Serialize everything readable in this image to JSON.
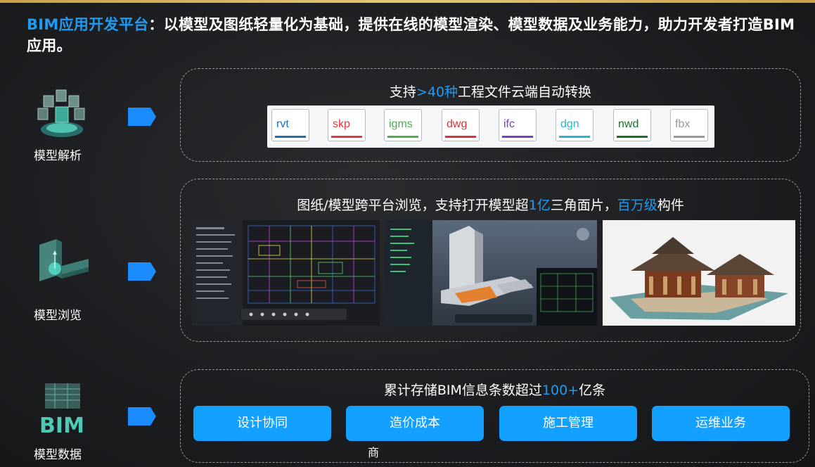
{
  "headline": {
    "accent": "BIM应用开发平台",
    "rest": "：以模型及图纸轻量化为基础，提供在线的模型渲染、模型数据及业务能力，助力开发者打造BIM应用。"
  },
  "rows": [
    {
      "label": "模型解析",
      "icon": "model-parse-icon"
    },
    {
      "label": "模型浏览",
      "icon": "model-browse-icon"
    },
    {
      "label": "模型数据",
      "icon": "bim-data-icon"
    }
  ],
  "panel1": {
    "title_pre": "支持",
    "title_hl": ">40种",
    "title_post": "工程文件云端自动转换",
    "formats": [
      {
        "ext": "rvt",
        "color": "#1f6fb5"
      },
      {
        "ext": "skp",
        "color": "#e03a3e"
      },
      {
        "ext": "igms",
        "color": "#4cae4f"
      },
      {
        "ext": "dwg",
        "color": "#d2363c"
      },
      {
        "ext": "ifc",
        "color": "#7a3fc4"
      },
      {
        "ext": "dgn",
        "color": "#2fb3c8"
      },
      {
        "ext": "nwd",
        "color": "#1b6e2a"
      },
      {
        "ext": "fbx",
        "color": "#9a9a9a"
      }
    ]
  },
  "panel2": {
    "title_pre": "图纸/模型跨平台浏览，支持打开模型超",
    "title_hl1": "1亿",
    "title_mid": "三角面片，",
    "title_hl2": "百万级",
    "title_post": "构件",
    "screenshots": [
      "cad-drawing-screenshot",
      "3d-model-screenshot",
      "ancient-building-render"
    ]
  },
  "panel3": {
    "title_pre": "累计存储BIM信息条数超过",
    "title_hl": "100+",
    "title_post": "亿条",
    "buttons": [
      "设计协同",
      "造价成本",
      "施工管理",
      "运维业务"
    ]
  },
  "stray_glyph": "商",
  "colors": {
    "accent": "#1f9bf0",
    "button": "#14a0ff",
    "background": "#1d1e21"
  }
}
